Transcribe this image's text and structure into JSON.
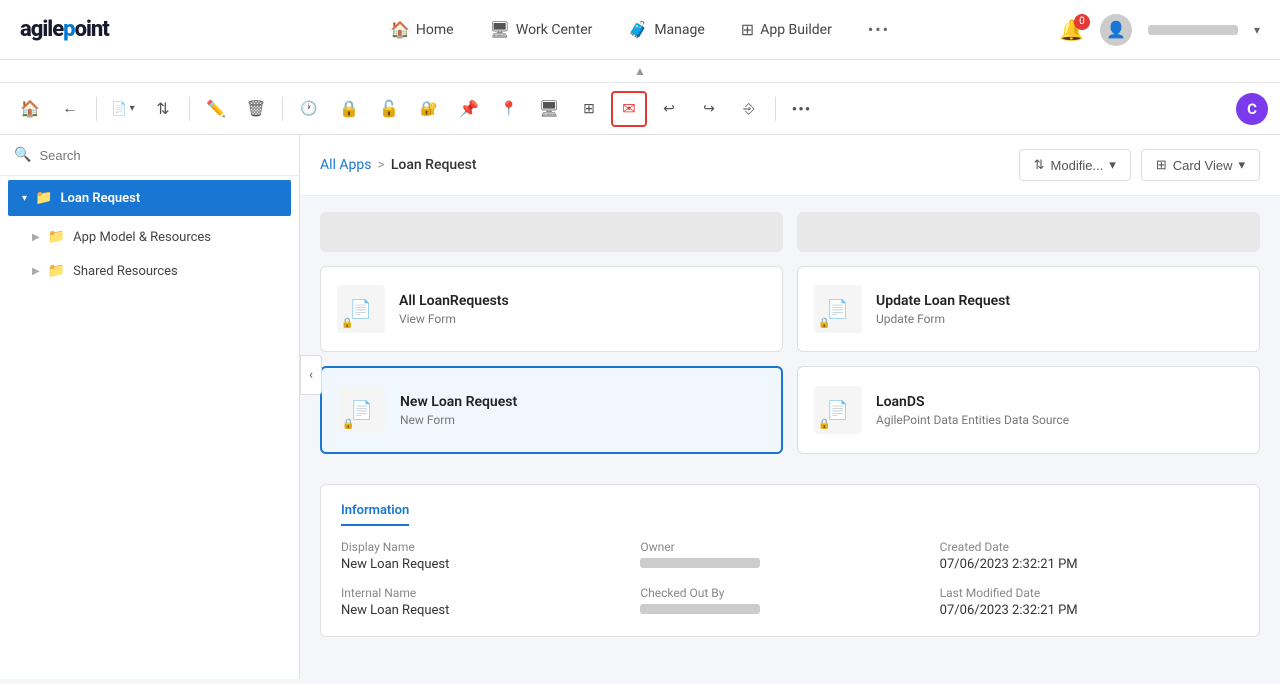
{
  "app": {
    "logo": "agilepoint",
    "logo_dot_char": "●"
  },
  "topnav": {
    "items": [
      {
        "id": "home",
        "label": "Home",
        "icon": "🏠"
      },
      {
        "id": "workcenter",
        "label": "Work Center",
        "icon": "🖥"
      },
      {
        "id": "manage",
        "label": "Manage",
        "icon": "🧳"
      },
      {
        "id": "appbuilder",
        "label": "App Builder",
        "icon": "⊞"
      }
    ],
    "more_icon": "•••",
    "notif_count": "0",
    "user_chevron": "▾"
  },
  "toolbar": {
    "buttons": [
      {
        "id": "home",
        "icon": "🏠",
        "active": false
      },
      {
        "id": "back",
        "icon": "←",
        "active": false
      },
      {
        "id": "new",
        "icon": "📄▾",
        "active": false
      },
      {
        "id": "sort",
        "icon": "⇅",
        "active": false
      },
      {
        "id": "edit",
        "icon": "✏️",
        "active": false
      },
      {
        "id": "delete",
        "icon": "🗑",
        "active": false
      },
      {
        "id": "history",
        "icon": "🕐",
        "active": false
      },
      {
        "id": "lock",
        "icon": "🔒",
        "active": false
      },
      {
        "id": "unlock",
        "icon": "🔓",
        "active": false
      },
      {
        "id": "lockalt",
        "icon": "🔐",
        "active": false
      },
      {
        "id": "pin",
        "icon": "📌",
        "active": false
      },
      {
        "id": "location",
        "icon": "📍",
        "active": false
      },
      {
        "id": "screen",
        "icon": "🖥",
        "active": false
      },
      {
        "id": "grid",
        "icon": "⊞",
        "active": false
      },
      {
        "id": "email",
        "icon": "✉",
        "active": true
      },
      {
        "id": "reply",
        "icon": "↩",
        "active": false
      },
      {
        "id": "forward",
        "icon": "↪",
        "active": false
      },
      {
        "id": "signin",
        "icon": "⎆",
        "active": false
      }
    ],
    "more": "•••",
    "circle_label": "C"
  },
  "sidebar": {
    "search_placeholder": "Search",
    "active_item": {
      "label": "Loan Request",
      "icon": "📁"
    },
    "sub_items": [
      {
        "id": "app-model",
        "label": "App Model & Resources",
        "icon": "📁"
      },
      {
        "id": "shared",
        "label": "Shared Resources",
        "icon": "📁"
      }
    ]
  },
  "content": {
    "breadcrumb": {
      "parent": "All Apps",
      "separator": ">",
      "current": "Loan Request"
    },
    "sort_label": "Modifie...",
    "view_label": "Card View",
    "cards": [
      {
        "id": "all-loan-requests",
        "title": "All LoanRequests",
        "subtitle": "View Form",
        "selected": false
      },
      {
        "id": "update-loan-request",
        "title": "Update Loan Request",
        "subtitle": "Update Form",
        "selected": false
      },
      {
        "id": "new-loan-request",
        "title": "New Loan Request",
        "subtitle": "New Form",
        "selected": true
      },
      {
        "id": "loands",
        "title": "LoanDS",
        "subtitle": "AgilePoint Data Entities Data Source",
        "selected": false
      }
    ],
    "info_panel": {
      "tab": "Information",
      "fields": [
        {
          "label": "Display Name",
          "value": "New Loan Request",
          "blurred": false
        },
        {
          "label": "Owner",
          "value": "",
          "blurred": true
        },
        {
          "label": "Created Date",
          "value": "07/06/2023 2:32:21 PM",
          "blurred": false
        },
        {
          "label": "Internal Name",
          "value": "New Loan Request",
          "blurred": false
        },
        {
          "label": "Checked Out By",
          "value": "",
          "blurred": true
        },
        {
          "label": "Last Modified Date",
          "value": "07/06/2023 2:32:21 PM",
          "blurred": false
        }
      ]
    }
  }
}
